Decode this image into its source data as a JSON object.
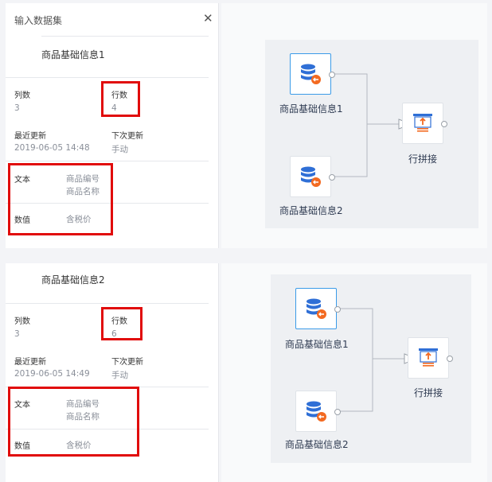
{
  "panel1": {
    "header_title": "输入数据集",
    "dataset_name": "商品基础信息1",
    "columns_label": "列数",
    "columns_value": "3",
    "rows_label": "行数",
    "rows_value": "4",
    "last_update_label": "最近更新",
    "last_update_value": "2019-06-05 14:48",
    "next_update_label": "下次更新",
    "next_update_value": "手动",
    "text_type_label": "文本",
    "text_fields": [
      "商品编号",
      "商品名称"
    ],
    "number_type_label": "数值",
    "number_fields": [
      "含税价"
    ]
  },
  "flow1": {
    "nodes": [
      "商品基础信息1",
      "商品基础信息2",
      "行拼接"
    ]
  },
  "panel2": {
    "dataset_name": "商品基础信息2",
    "columns_label": "列数",
    "columns_value": "3",
    "rows_label": "行数",
    "rows_value": "6",
    "last_update_label": "最近更新",
    "last_update_value": "2019-06-05 14:49",
    "next_update_label": "下次更新",
    "next_update_value": "手动",
    "text_type_label": "文本",
    "text_fields": [
      "商品编号",
      "商品名称"
    ],
    "number_type_label": "数值",
    "number_fields": [
      "含税价"
    ]
  },
  "flow2": {
    "nodes": [
      "商品基础信息1",
      "商品基础信息2",
      "行拼接"
    ]
  },
  "colors": {
    "highlight_box": "#e10b0b",
    "db_blue": "#2f6fd6",
    "badge_orange": "#f36a21",
    "selected_border": "#3b9be8"
  }
}
